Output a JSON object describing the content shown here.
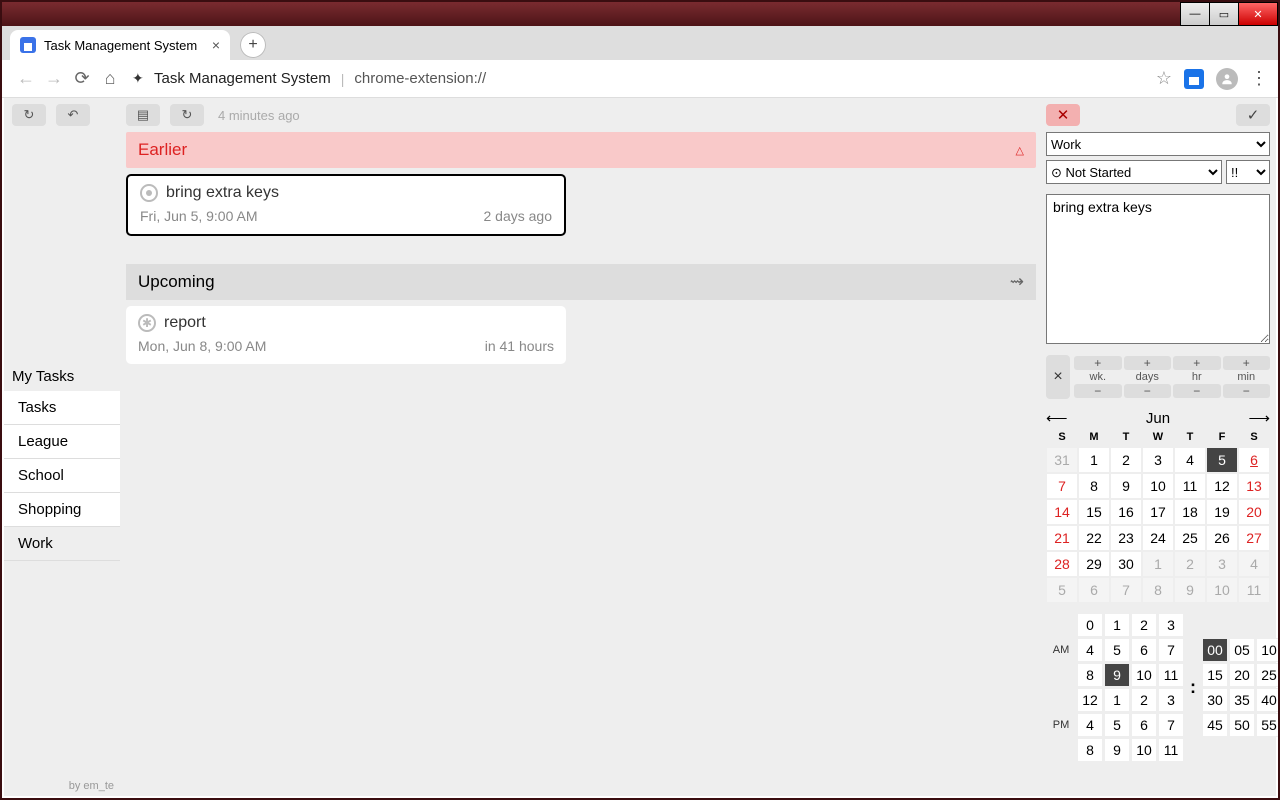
{
  "window": {
    "title": "Task Management System"
  },
  "browser": {
    "tab_title": "Task Management System",
    "ext_name": "Task Management System",
    "url": "chrome-extension://"
  },
  "sidebar": {
    "heading": "My Tasks",
    "items": [
      "Tasks",
      "League",
      "School",
      "Shopping",
      "Work"
    ],
    "selected": "Work",
    "footer": "by em_te"
  },
  "toolbar": {
    "last_sync": "4 minutes ago"
  },
  "sections": {
    "earlier": "Earlier",
    "upcoming": "Upcoming"
  },
  "tasks": {
    "earlier": [
      {
        "title": "bring extra keys",
        "when": "Fri, Jun 5, 9:00 AM",
        "rel": "2 days ago",
        "selected": true,
        "icon": "dot"
      }
    ],
    "upcoming": [
      {
        "title": "report",
        "when": "Mon, Jun 8, 9:00 AM",
        "rel": "in 41 hours",
        "selected": false,
        "icon": "star"
      }
    ]
  },
  "detail": {
    "category": "Work",
    "status_options": [
      "⊙ Not Started"
    ],
    "status": "⊙ Not Started",
    "priority_options": [
      "!!"
    ],
    "priority": "!!",
    "text": "bring extra keys",
    "recur_labels": [
      "wk.",
      "days",
      "hr",
      "min"
    ]
  },
  "calendar": {
    "month_label": "Jun",
    "weekdays": [
      "S",
      "M",
      "T",
      "W",
      "T",
      "F",
      "S"
    ],
    "selected_day": 5,
    "today": 6,
    "weeks": [
      [
        {
          "n": 31,
          "out": true
        },
        {
          "n": 1
        },
        {
          "n": 2
        },
        {
          "n": 3
        },
        {
          "n": 4
        },
        {
          "n": 5
        },
        {
          "n": 6
        }
      ],
      [
        {
          "n": 7
        },
        {
          "n": 8
        },
        {
          "n": 9
        },
        {
          "n": 10
        },
        {
          "n": 11
        },
        {
          "n": 12
        },
        {
          "n": 13
        }
      ],
      [
        {
          "n": 14
        },
        {
          "n": 15
        },
        {
          "n": 16
        },
        {
          "n": 17
        },
        {
          "n": 18
        },
        {
          "n": 19
        },
        {
          "n": 20
        }
      ],
      [
        {
          "n": 21
        },
        {
          "n": 22
        },
        {
          "n": 23
        },
        {
          "n": 24
        },
        {
          "n": 25
        },
        {
          "n": 26
        },
        {
          "n": 27
        }
      ],
      [
        {
          "n": 28
        },
        {
          "n": 29
        },
        {
          "n": 30
        },
        {
          "n": 1,
          "out": true
        },
        {
          "n": 2,
          "out": true
        },
        {
          "n": 3,
          "out": true
        },
        {
          "n": 4,
          "out": true
        }
      ],
      [
        {
          "n": 5,
          "out": true
        },
        {
          "n": 6,
          "out": true
        },
        {
          "n": 7,
          "out": true
        },
        {
          "n": 8,
          "out": true
        },
        {
          "n": 9,
          "out": true
        },
        {
          "n": 10,
          "out": true
        },
        {
          "n": 11,
          "out": true
        }
      ]
    ]
  },
  "time": {
    "am_label": "AM",
    "pm_label": "PM",
    "hours_am": [
      [
        0,
        1,
        2,
        3
      ],
      [
        4,
        5,
        6,
        7
      ],
      [
        8,
        9,
        10,
        11
      ]
    ],
    "hours_pm": [
      [
        12,
        1,
        2,
        3
      ],
      [
        4,
        5,
        6,
        7
      ],
      [
        8,
        9,
        10,
        11
      ]
    ],
    "minutes": [
      [
        "00",
        "05",
        "10"
      ],
      [
        "15",
        "20",
        "25"
      ],
      [
        "30",
        "35",
        "40"
      ],
      [
        "45",
        "50",
        "55"
      ]
    ],
    "selected_hour_row": 2,
    "selected_hour_col": 1,
    "selected_hour_block": "am",
    "selected_min": "00"
  }
}
